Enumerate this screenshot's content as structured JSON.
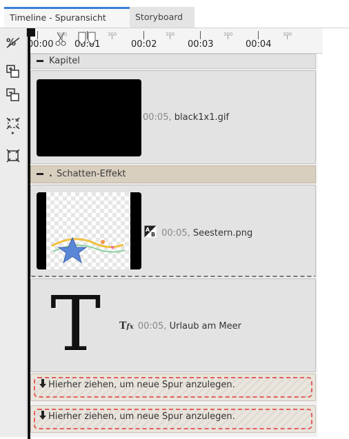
{
  "tabs": [
    {
      "label": "Timeline - Spuransicht",
      "active": true
    },
    {
      "label": "Storyboard",
      "active": false
    }
  ],
  "ruler": {
    "labels": [
      "00:00",
      "00:01",
      "00:02",
      "00:03",
      "00:04"
    ],
    "sub_label": "300"
  },
  "toolbar": {
    "tools": [
      "zoom-fit-icon",
      "add-track-icon",
      "remove-track-icon",
      "expand-icon",
      "collapse-icon"
    ]
  },
  "chapter": {
    "title": "Kapitel"
  },
  "clips": [
    {
      "time": "00:05,",
      "name": "black1x1.gif"
    },
    {
      "time": "00:05,",
      "name": "Seestern.png"
    },
    {
      "time": "00:05,",
      "name": "Urlaub am Meer"
    }
  ],
  "effect": {
    "title": "Schatten-Effekt"
  },
  "text_clip": {
    "glyph": "T"
  },
  "drop_zones": [
    {
      "label": "Hierher ziehen, um neue Spur anzulegen."
    },
    {
      "label": "Hierher ziehen, um neue Spur anzulegen."
    }
  ],
  "colors": {
    "accent": "#3b7dd8",
    "effect_bg": "#d9cfbf",
    "drop_border": "#e0605c"
  }
}
